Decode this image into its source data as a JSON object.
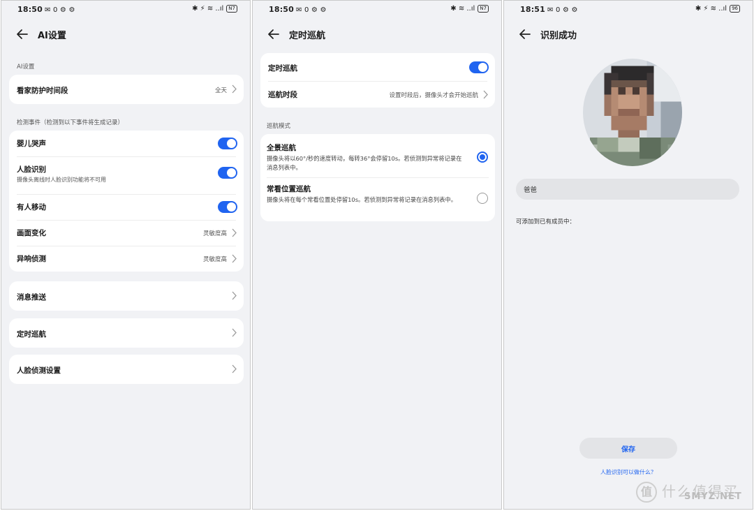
{
  "panel1": {
    "status": {
      "time": "18:50",
      "icons": "✉ 0 ⚙ ⚙",
      "right": "✱ ⚡ ≋ ..ıl",
      "battery": "N7"
    },
    "title": "AI设置",
    "section_ai": "AI设置",
    "guard_row": {
      "label": "看家防护时间段",
      "value": "全天"
    },
    "section_detect": "检测事件（检测到以下事件将生成记录）",
    "detect_rows": [
      {
        "label": "婴儿哭声",
        "toggle": "on"
      },
      {
        "label": "人脸识别",
        "sub": "摄像头离线时人脸识别功能将不可用",
        "toggle": "on"
      },
      {
        "label": "有人移动",
        "toggle": "on"
      },
      {
        "label": "画面变化",
        "value": "灵敏度高"
      },
      {
        "label": "异响侦测",
        "value": "灵敏度高"
      }
    ],
    "push_label": "消息推送",
    "cruise_label": "定时巡航",
    "face_settings_label": "人脸侦测设置"
  },
  "panel2": {
    "status": {
      "time": "18:50",
      "icons": "✉ 0 ⚙ ⚙",
      "right": "✱ ≋ ..ıl",
      "battery": "N7"
    },
    "title": "定时巡航",
    "cruise_toggle_label": "定时巡航",
    "cruise_time": {
      "label": "巡航时段",
      "value": "设置时段后，摄像头才会开始巡航"
    },
    "section_mode": "巡航模式",
    "modes": [
      {
        "label": "全景巡航",
        "desc": "摄像头将以60°/秒的速度转动，每转36°会停留10s。若侦测到异常将记录在消息列表中。",
        "selected": true
      },
      {
        "label": "常看位置巡航",
        "desc": "摄像头将在每个常看位置处停留10s。若侦测到异常将记录在消息列表中。",
        "selected": false
      }
    ]
  },
  "panel3": {
    "status": {
      "time": "18:51",
      "icons": "✉ 0 ⚙ ⚙",
      "right": "✱ ⚡ ≋ ..ıl",
      "battery": "96"
    },
    "title": "识别成功",
    "name_value": "爸爸",
    "add_label": "可添加到已有成员中：",
    "save_label": "保存",
    "help_link": "人脸识别可以做什么？"
  },
  "watermark": {
    "glyph": "值",
    "text": "什么值得买",
    "sub": "SMYZ.NET"
  },
  "colors": {
    "accent": "#2064f0",
    "background": "#f1f2f5",
    "card": "#ffffff"
  }
}
